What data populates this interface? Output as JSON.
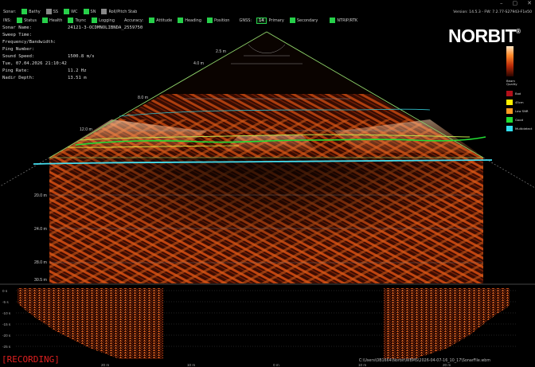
{
  "window": {
    "version": "Version: 14.5.3 - FW: 7.2.77-S27943-F1e50"
  },
  "toolbar": {
    "row1": {
      "sonar_label": "Sonar:",
      "items": [
        {
          "label": "Bathy",
          "checked": true
        },
        {
          "label": "SS",
          "checked": false
        },
        {
          "label": "WC",
          "checked": true
        },
        {
          "label": "SN",
          "checked": true
        },
        {
          "label": "Roll/Pitch Stab",
          "checked": false
        }
      ]
    },
    "row2": {
      "ins_label": "INS:",
      "ins_items": [
        {
          "label": "Status",
          "checked": true
        },
        {
          "label": "Health",
          "checked": true
        },
        {
          "label": "Tsync",
          "checked": true
        },
        {
          "label": "Logging",
          "checked": true
        }
      ],
      "accuracy_label": "Accuracy:",
      "accuracy_items": [
        {
          "label": "Attitude",
          "checked": true
        },
        {
          "label": "Heading",
          "checked": true
        },
        {
          "label": "Position",
          "checked": true
        }
      ],
      "gnss_label": "GNSS:",
      "gnss_primary_count": "14",
      "gnss_primary_label": "Primary",
      "gnss_secondary_label": "Secondary",
      "ntrip_label": "NTRIP/RTK"
    }
  },
  "info_panel": [
    {
      "key": "Sonar Name:",
      "value": "24121-3-OCDMNOLIBNDA_2559750"
    },
    {
      "key": "Sweep Time:",
      "value": ""
    },
    {
      "key": "Frequency/Bandwidth:",
      "value": ""
    },
    {
      "key": "Ping Number:",
      "value": ""
    },
    {
      "key": "Sound Speed:",
      "value": "1500.8 m/s"
    },
    {
      "key": "Tue, 07.04.2026 21:10:42",
      "value": ""
    },
    {
      "key": "Ping Rate:",
      "value": "11.2 Hz"
    },
    {
      "key": "Nadir Depth:",
      "value": "13.51 m"
    }
  ],
  "brand": {
    "logo": "NORBIT",
    "reg": "®"
  },
  "legend": {
    "title": "Beam Quality",
    "items": [
      {
        "label": "Bad",
        "color": "#b0101a"
      },
      {
        "label": "45cm",
        "color": "#ffee00"
      },
      {
        "label": "Low SNR",
        "color": "#ff9a22"
      },
      {
        "label": "Good",
        "color": "#22dd33"
      },
      {
        "label": "Multidetect",
        "color": "#30ddee"
      }
    ]
  },
  "range_labels": {
    "r2_5": "2.5 m",
    "r4_0": "4.0 m",
    "r8_0": "8.0 m",
    "r12_0": "12.0 m",
    "r20_0": "20.0 m",
    "r24_0": "24.0 m",
    "r28_0": "28.0 m",
    "r30_5": "30.5 m"
  },
  "waterfall": {
    "y_ticks": [
      "0 s",
      "-5 s",
      "-10 s",
      "-15 s",
      "-20 s",
      "-25 s"
    ],
    "x_ticks": [
      "20 m",
      "10 m",
      "0 m",
      "10 m",
      "20 m"
    ]
  },
  "status": {
    "recording": "[RECORDING]",
    "file_path": "C:\\Users\\OB1664\\Norbit\\WBMS\\2026-04-07-16_10_17\\SonarFile.wbm"
  },
  "colors": {
    "accent_green": "#27d04a",
    "beam_line": "#8fd46a",
    "bottom_line": "#44ddee"
  }
}
